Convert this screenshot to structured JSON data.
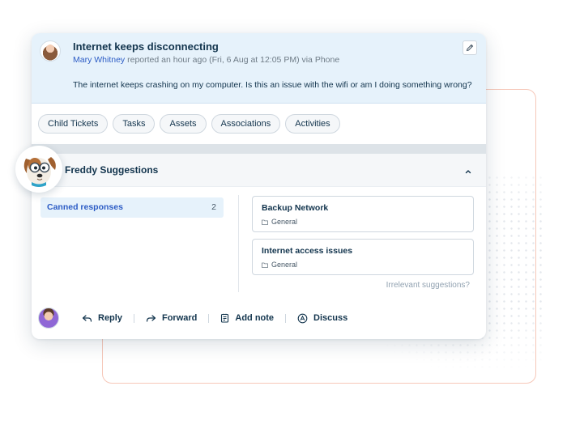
{
  "ticket": {
    "title": "Internet keeps disconnecting",
    "requester": "Mary Whitney",
    "meta_rest": " reported an hour ago (Fri, 6 Aug at 12:05 PM) via Phone",
    "body": "The internet keeps crashing on my computer. Is this an issue with the wifi or am I doing something wrong?"
  },
  "tabs": [
    {
      "label": "Child Tickets"
    },
    {
      "label": "Tasks"
    },
    {
      "label": "Assets"
    },
    {
      "label": "Associations"
    },
    {
      "label": "Activities"
    }
  ],
  "freddy": {
    "title": "Freddy Suggestions",
    "canned": {
      "label": "Canned responses",
      "count": "2"
    },
    "suggestions": [
      {
        "title": "Backup Network",
        "folder": "General"
      },
      {
        "title": "Internet access issues",
        "folder": "General"
      }
    ],
    "irrelevant": "Irrelevant suggestions?"
  },
  "actions": {
    "reply": "Reply",
    "forward": "Forward",
    "add_note": "Add note",
    "discuss": "Discuss"
  },
  "icons": {
    "edit": "pencil-icon",
    "collapse": "chevron-up-icon",
    "folder": "folder-icon",
    "reply": "reply-arrow-icon",
    "forward": "forward-arrow-icon",
    "add_note": "note-icon",
    "discuss": "discuss-icon"
  },
  "colors": {
    "header_bg": "#e6f2fb",
    "link": "#2c5cc5",
    "text": "#12344d",
    "accent_frame": "#f6c8b9"
  }
}
